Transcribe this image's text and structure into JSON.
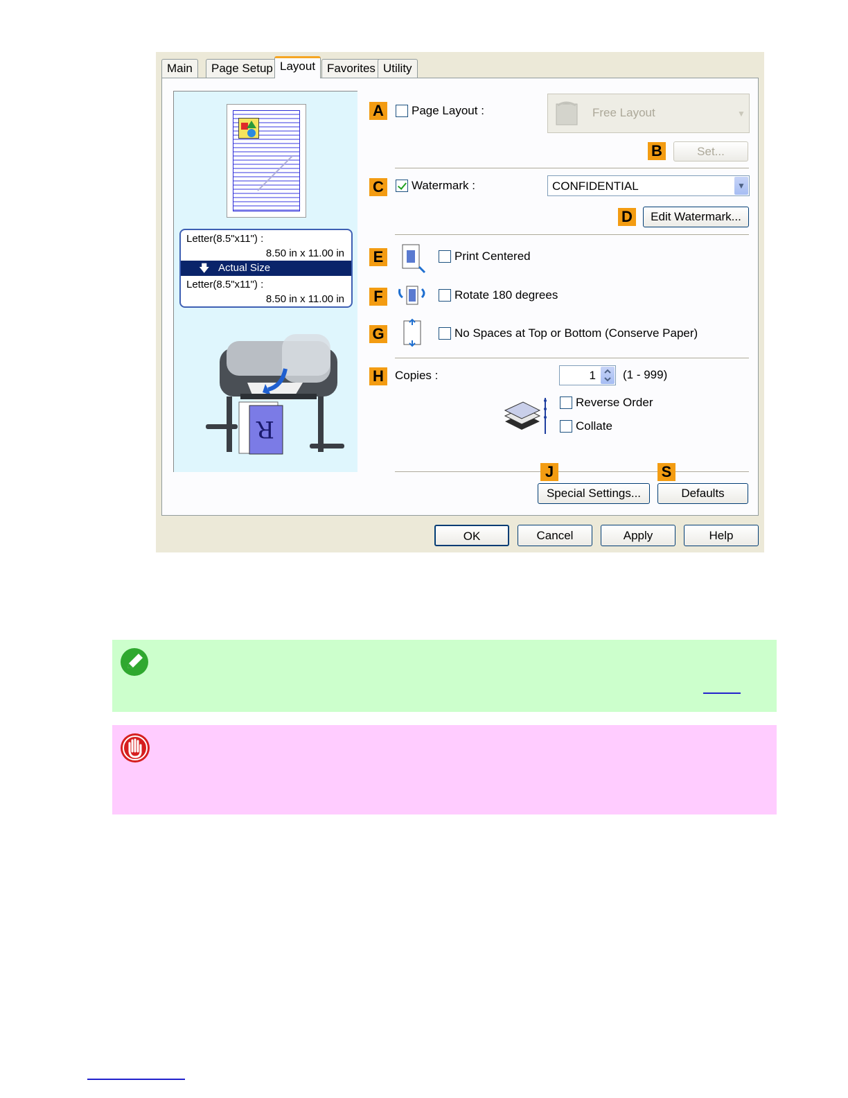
{
  "dialog": {
    "tabs": [
      "Main",
      "Page Setup",
      "Layout",
      "Favorites",
      "Utility"
    ],
    "active_tab": "Layout",
    "preview": {
      "size_from": "Letter(8.5\"x11\") :",
      "size_from_dims": "8.50 in x 11.00 in",
      "scale": "Actual Size",
      "size_to": "Letter(8.5\"x11\") :",
      "size_to_dims": "8.50 in x 11.00 in"
    },
    "badges": {
      "a": "A",
      "b": "B",
      "c": "C",
      "d": "D",
      "e": "E",
      "f": "F",
      "g": "G",
      "h": "H",
      "j": "J",
      "s": "S"
    },
    "page_layout": {
      "label": "Page Layout :",
      "checked": false,
      "value": "Free Layout"
    },
    "set_button": "Set...",
    "watermark": {
      "label": "Watermark :",
      "checked": true,
      "value": "CONFIDENTIAL"
    },
    "edit_watermark_button": "Edit Watermark...",
    "print_centered": {
      "label": "Print Centered",
      "checked": false
    },
    "rotate": {
      "label": "Rotate 180 degrees",
      "checked": false
    },
    "no_spaces": {
      "label": "No Spaces at Top or Bottom (Conserve Paper)",
      "checked": false
    },
    "copies": {
      "label": "Copies :",
      "value": "1",
      "range": "(1 - 999)"
    },
    "reverse_order": {
      "label": "Reverse Order",
      "checked": false
    },
    "collate": {
      "label": "Collate",
      "checked": false
    },
    "special_settings_button": "Special Settings...",
    "defaults_button": "Defaults",
    "footer": {
      "ok": "OK",
      "cancel": "Cancel",
      "apply": "Apply",
      "help": "Help"
    }
  },
  "colors": {
    "badge": "#f39c12",
    "note_bg": "#ccffcc",
    "important_bg": "#ffccff",
    "selection": "#0a246a"
  }
}
